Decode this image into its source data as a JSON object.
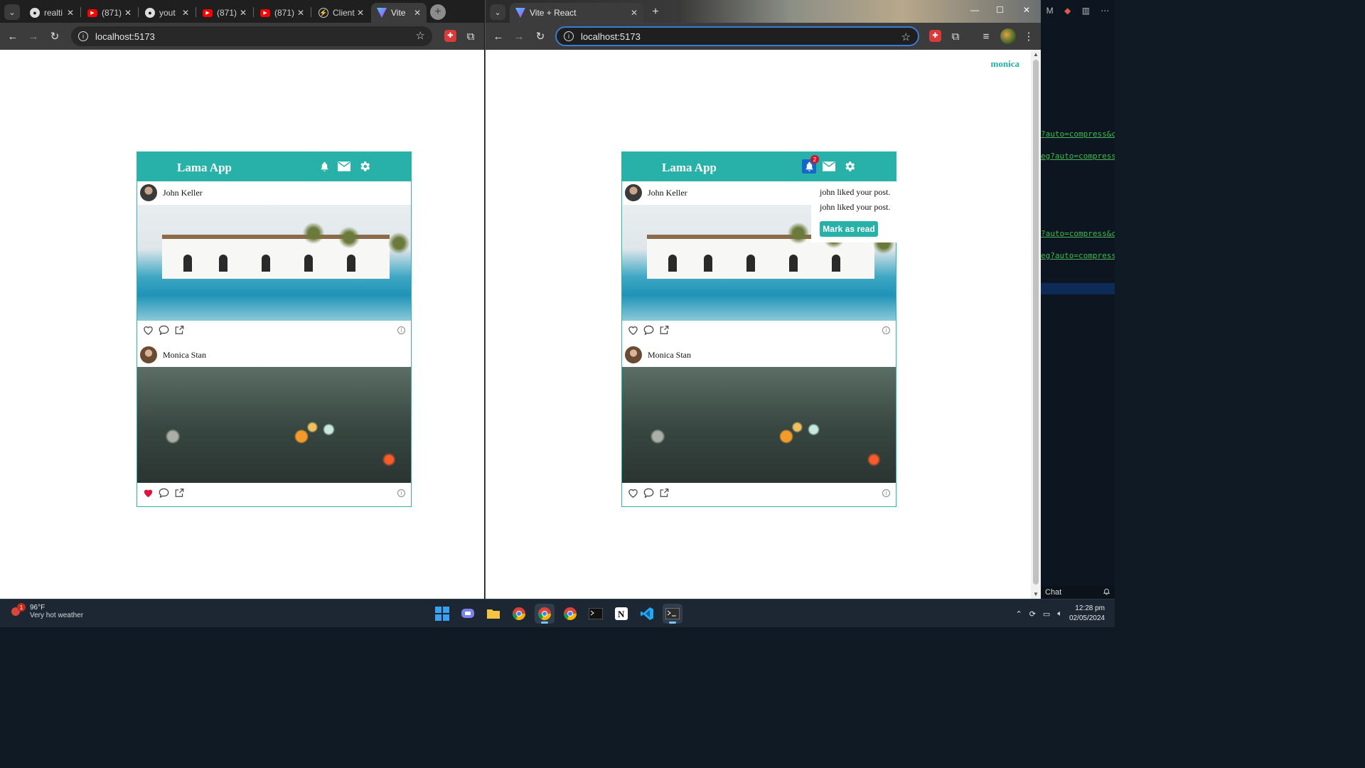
{
  "left_window": {
    "tabs": [
      {
        "label": "realti",
        "favicon": "github-icon"
      },
      {
        "label": "(871)",
        "favicon": "youtube-icon"
      },
      {
        "label": "yout",
        "favicon": "github-icon"
      },
      {
        "label": "(871)",
        "favicon": "youtube-icon"
      },
      {
        "label": "(871)",
        "favicon": "youtube-icon"
      },
      {
        "label": "Client",
        "favicon": "client-icon"
      },
      {
        "label": "Vite",
        "favicon": "vite-icon",
        "active": true
      }
    ],
    "url": "localhost:5173"
  },
  "right_window": {
    "tabs": [
      {
        "label": "Vite + React",
        "favicon": "vite-icon",
        "active": true
      }
    ],
    "url": "localhost:5173",
    "username": "monica"
  },
  "app": {
    "logo": "Lama App",
    "notification_count": "2",
    "posts": [
      {
        "username": "John Keller",
        "image": "pool-villa",
        "liked": false
      },
      {
        "username": "Monica Stan",
        "image": "rainy-window",
        "liked": true
      }
    ],
    "right_posts_liked": [
      false,
      false
    ],
    "notifications": [
      "john liked your post.",
      "john liked your post."
    ],
    "mark_as_read": "Mark as read"
  },
  "editor": {
    "code_lines": [
      "?auto=compress&cs",
      "eg?auto=compress&",
      "?auto=compress&cs",
      "eg?auto=compress&"
    ],
    "header_text": "M",
    "chat_label": "Chat"
  },
  "taskbar": {
    "weather_temp": "96°F",
    "weather_desc": "Very hot weather",
    "weather_badge": "1",
    "time": "12:28 pm",
    "date": "02/05/2024"
  },
  "colors": {
    "accent": "#27b1a8",
    "badge": "#d0142c",
    "like": "#e0113b"
  }
}
